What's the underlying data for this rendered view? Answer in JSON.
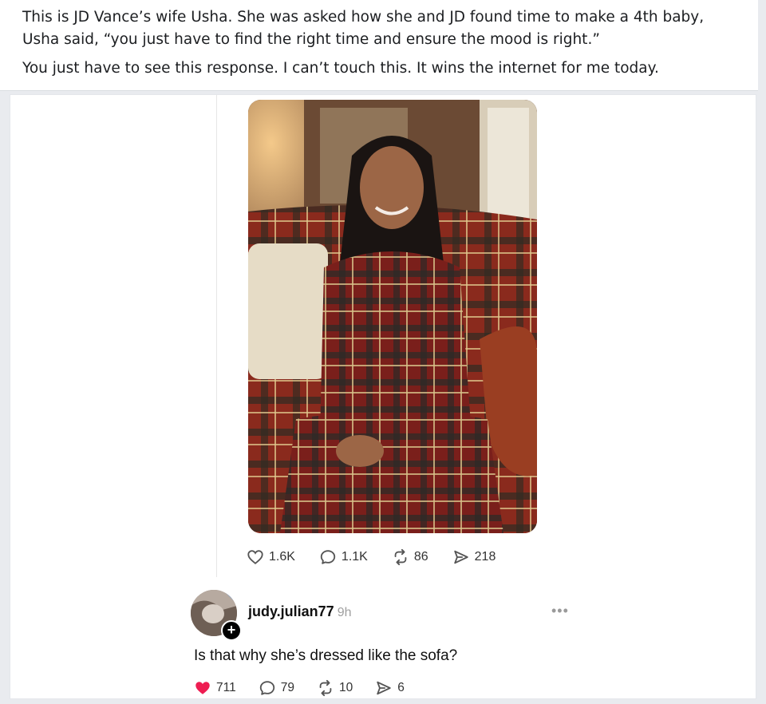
{
  "caption": {
    "line1": "This is JD Vance’s wife Usha. She was asked how she and JD found time to make a 4th baby, Usha said, “you just have to find the right time and ensure the mood is right.”",
    "line2": "You just have to see this response. I can’t touch this. It wins the internet for me today."
  },
  "post": {
    "stats": {
      "likes": "1.6K",
      "replies": "1.1K",
      "reposts": "86",
      "shares": "218"
    }
  },
  "reply": {
    "username": "judy.julian77",
    "time": "9h",
    "text": "Is that why she’s dressed like the sofa?",
    "stats": {
      "likes": "711",
      "replies": "79",
      "reposts": "10",
      "shares": "6"
    },
    "liked": true,
    "follow_glyph": "+"
  },
  "icons": {
    "like": "heart-icon",
    "reply": "speech-bubble-icon",
    "repost": "repost-arrows-icon",
    "share": "send-arrow-icon",
    "more": "more-dots-icon"
  },
  "colors": {
    "like_active": "#ee1d52",
    "icon_gray": "#555555"
  }
}
